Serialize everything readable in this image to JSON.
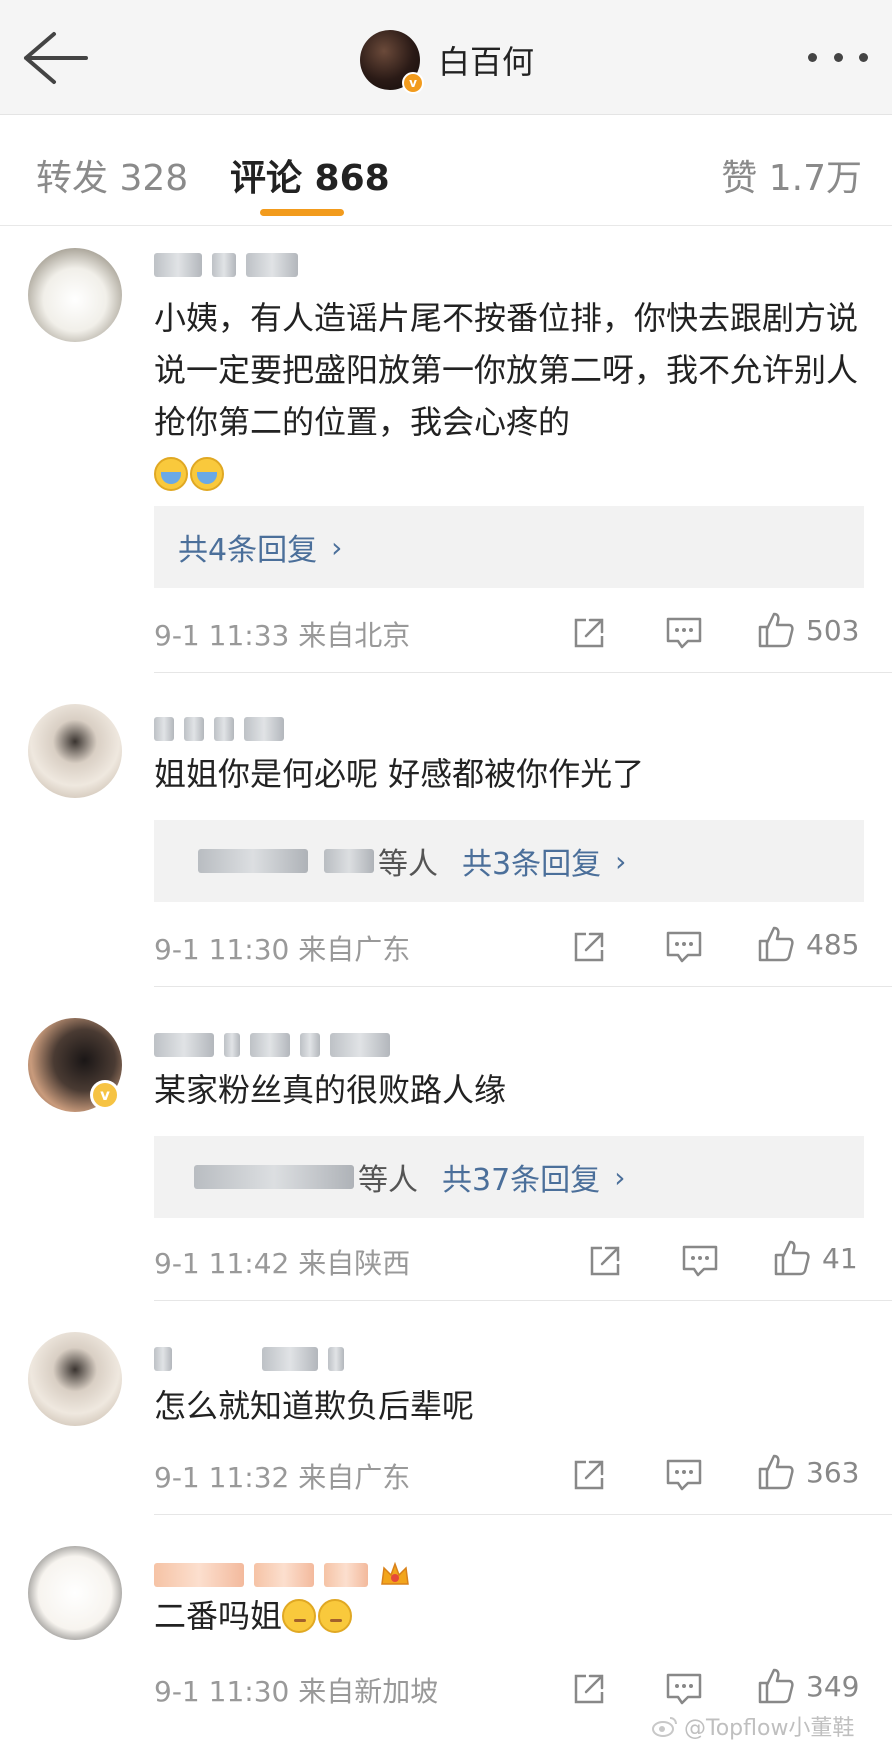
{
  "header": {
    "title": "白百何",
    "verified_badge": "v"
  },
  "tabs": [
    {
      "label": "转发 328"
    },
    {
      "label": "评论 868"
    },
    {
      "label": "赞 1.7万"
    }
  ],
  "comments": [
    {
      "text": "小姨，有人造谣片尾不按番位排，你快去跟剧方说说一定要把盛阳放第一你放第二呀，我不允许别人抢你第二的位置，我会心疼的",
      "reply": "共4条回复",
      "reply_prefix": "",
      "meta": "9-1 11:33  来自北京",
      "likes": "503"
    },
    {
      "text": "姐姐你是何必呢 好感都被你作光了",
      "reply": "共3条回复",
      "reply_prefix": "等人",
      "meta": "9-1 11:30  来自广东",
      "likes": "485"
    },
    {
      "text": "某家粉丝真的很败路人缘",
      "reply": "共37条回复",
      "reply_prefix": "等人",
      "meta": "9-1 11:42  来自陕西",
      "likes": "41",
      "verified": "v"
    },
    {
      "text": "怎么就知道欺负后辈呢",
      "meta": "9-1 11:32  来自广东",
      "likes": "363"
    },
    {
      "text": "二番吗姐",
      "meta": "9-1 11:30  来自新加坡",
      "likes": "349"
    }
  ],
  "reply_chevron": "›",
  "watermark": "@Topflow小董鞋",
  "colors": {
    "accent": "#f29b1d",
    "link": "#4b6f9a",
    "meta": "#999999"
  }
}
